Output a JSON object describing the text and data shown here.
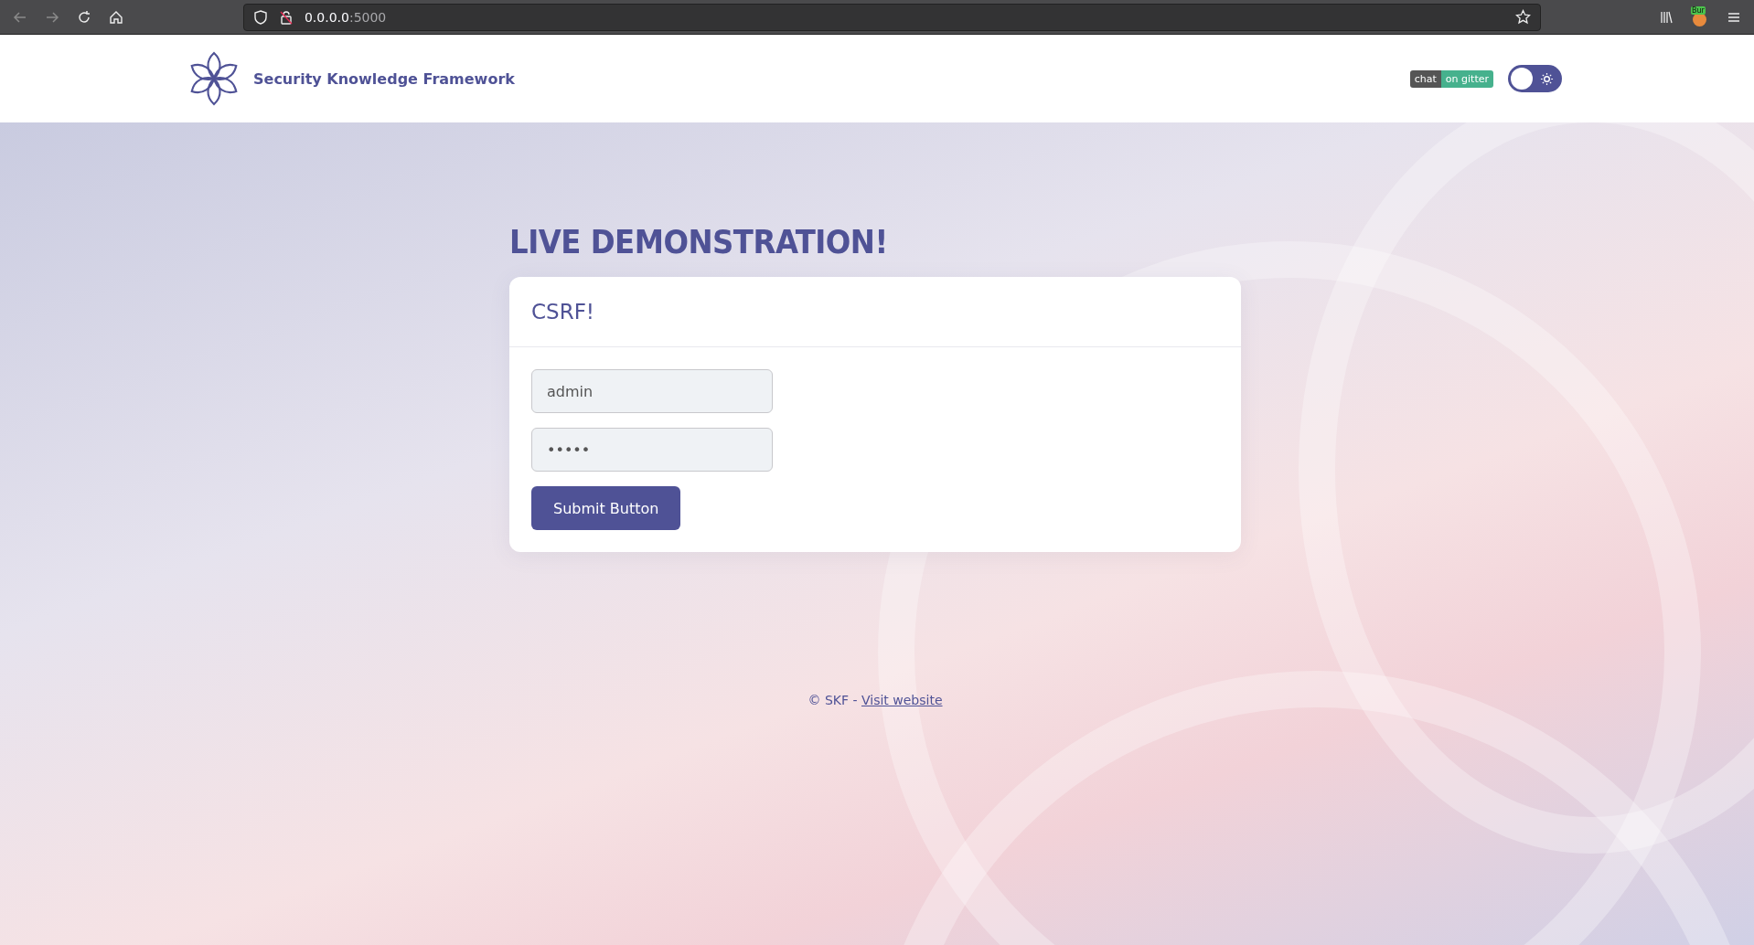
{
  "browser": {
    "url_host": "0.0.0.0",
    "url_port": ":5000",
    "extension_badge": "Bur"
  },
  "header": {
    "brand": "Security Knowledge Framework",
    "badge_left": "chat",
    "badge_right": "on gitter",
    "theme_toggle": {
      "on": false
    }
  },
  "heading": "LIVE DEMONSTRATION!",
  "card": {
    "title": "CSRF!",
    "fields": [
      {
        "value": "admin"
      },
      {
        "value": "•••••"
      }
    ],
    "button": "Submit Button"
  },
  "footer": {
    "text": "© SKF - ",
    "link": "Visit website"
  }
}
